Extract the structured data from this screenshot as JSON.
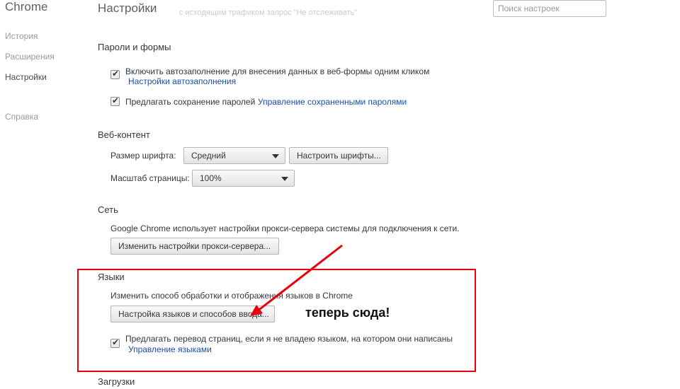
{
  "sidebar": {
    "brand": "Chrome",
    "items": [
      {
        "label": "История"
      },
      {
        "label": "Расширения"
      },
      {
        "label": "Настройки"
      },
      {
        "label": "Справка"
      }
    ]
  },
  "header": {
    "title": "Настройки",
    "ghost_text": "с исходящим трафиком запрос \"Не отслеживать\"",
    "search_placeholder": "Поиск настроек"
  },
  "passwords": {
    "title": "Пароли и формы",
    "autofill_label": "Включить автозаполнение для внесения данных в веб-формы одним кликом",
    "autofill_link": "Настройки автозаполнения",
    "save_passwords_label": "Предлагать сохранение паролей",
    "manage_passwords_link": "Управление сохраненными паролями"
  },
  "web_content": {
    "title": "Веб-контент",
    "font_size_label": "Размер шрифта:",
    "font_size_value": "Средний",
    "customize_fonts_button": "Настроить шрифты...",
    "zoom_label": "Масштаб страницы:",
    "zoom_value": "100%"
  },
  "network": {
    "title": "Сеть",
    "description": "Google Chrome использует настройки прокси-сервера системы для подключения к сети.",
    "proxy_button": "Изменить настройки прокси-сервера..."
  },
  "languages": {
    "title": "Языки",
    "description": "Изменить способ обработки и отображения языков в Chrome",
    "settings_button": "Настройка языков и способов ввода...",
    "translate_label": "Предлагать перевод страниц, если я не владею языком, на котором они написаны",
    "manage_languages_link": "Управление языками"
  },
  "downloads": {
    "title": "Загрузки"
  },
  "annotation": {
    "text": "теперь сюда!",
    "color": "#e8000b"
  }
}
